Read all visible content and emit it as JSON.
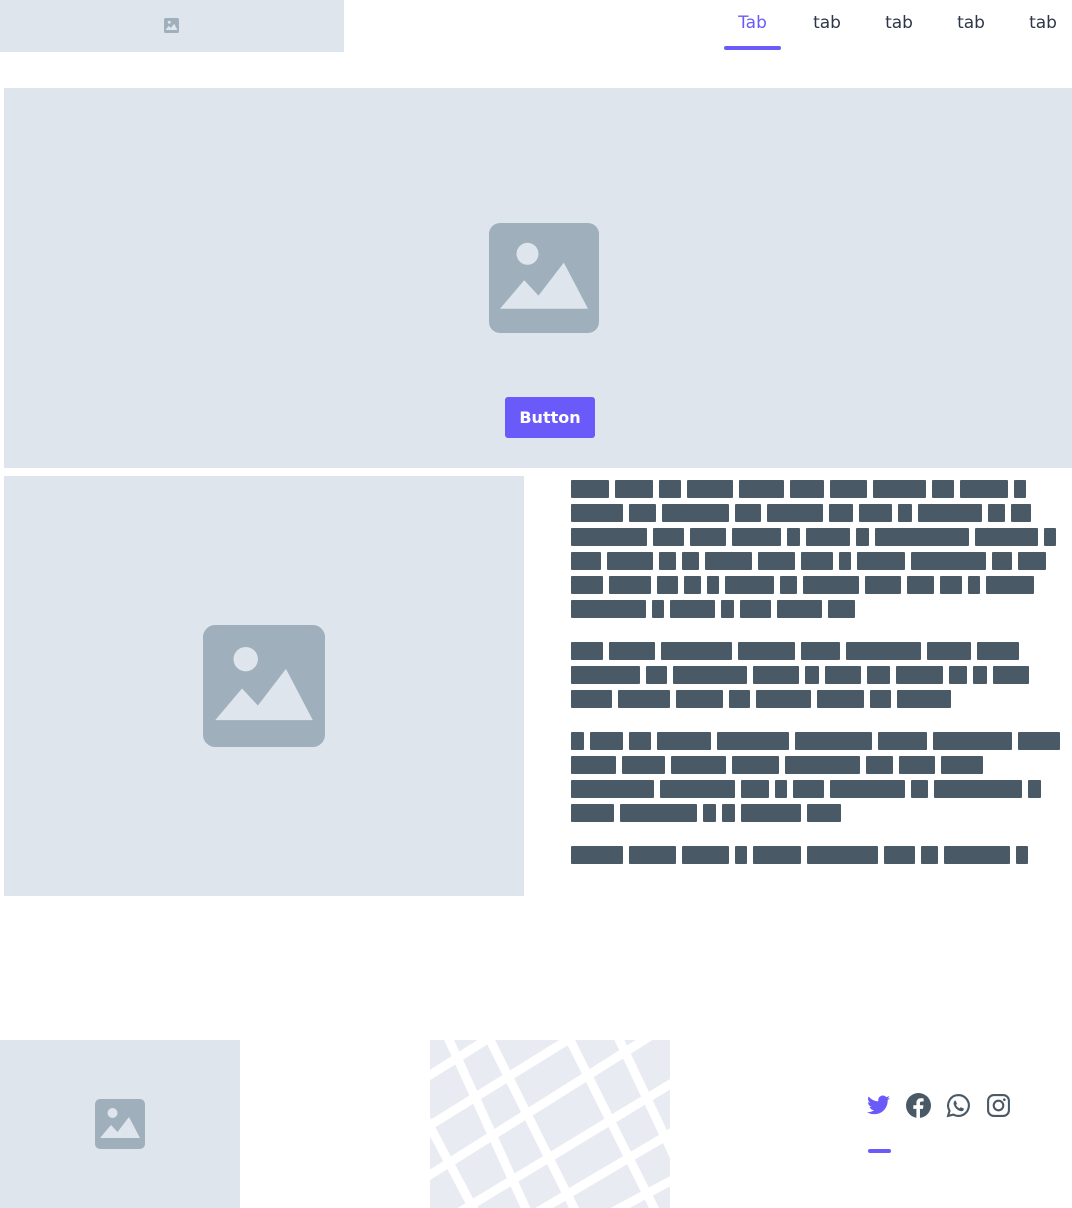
{
  "header": {
    "logo_icon": "image-placeholder-icon",
    "tabs": [
      {
        "label": "Tab",
        "active": true
      },
      {
        "label": "tab",
        "active": false
      },
      {
        "label": "tab",
        "active": false
      },
      {
        "label": "tab",
        "active": false
      },
      {
        "label": "tab",
        "active": false
      }
    ]
  },
  "hero": {
    "image_icon": "image-placeholder-icon",
    "button_label": "Button"
  },
  "content": {
    "image_icon": "image-placeholder-icon",
    "text_note": "placeholder text rendered as redacted word blocks"
  },
  "footer": {
    "image_icon": "image-placeholder-icon",
    "map": "map-placeholder",
    "social": [
      {
        "name": "twitter-icon",
        "color": "#6a5af9"
      },
      {
        "name": "facebook-icon",
        "color": "#4a5966"
      },
      {
        "name": "whatsapp-icon",
        "color": "#4a5966"
      },
      {
        "name": "instagram-icon",
        "color": "#4a5966"
      }
    ]
  },
  "colors": {
    "accent": "#6a5af9",
    "placeholder_bg": "#dfe5ed",
    "placeholder_icon": "#9fafbc",
    "text_block": "#4a5966"
  }
}
